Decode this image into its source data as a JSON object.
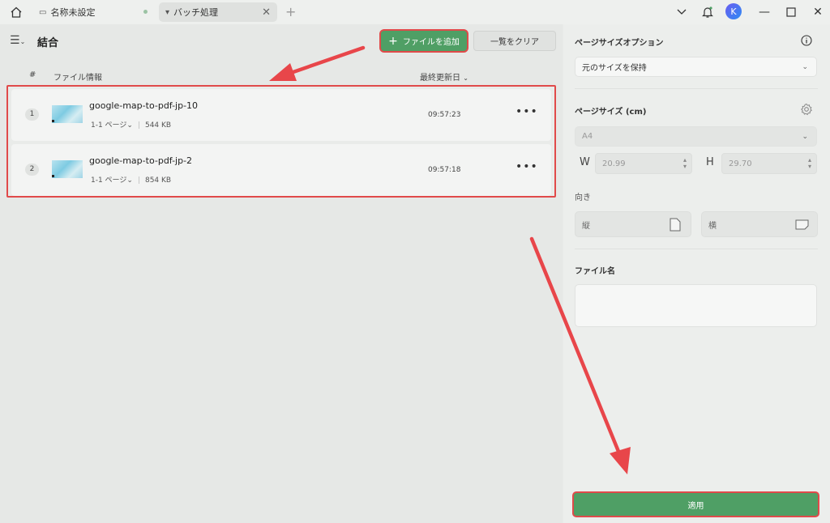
{
  "titlebar": {
    "tabs": [
      {
        "label": "名称未設定"
      },
      {
        "label": "バッチ処理"
      }
    ],
    "avatar_letter": "K"
  },
  "toolbar": {
    "title": "結合",
    "add_label": "ファイルを追加",
    "clear_label": "一覧をクリア"
  },
  "table": {
    "headers": {
      "index": "#",
      "file_info": "ファイル情報",
      "modified": "最終更新日"
    },
    "rows": [
      {
        "num": "1",
        "name": "google-map-to-pdf-jp-10",
        "pages": "1-1 ページ",
        "size": "544 KB",
        "time": "09:57:23"
      },
      {
        "num": "2",
        "name": "google-map-to-pdf-jp-2",
        "pages": "1-1 ページ",
        "size": "854 KB",
        "time": "09:57:18"
      }
    ]
  },
  "options": {
    "page_size_option_title": "ページサイズオプション",
    "page_size_option_value": "元のサイズを保持",
    "page_size_title": "ページサイズ (cm)",
    "paper": "A4",
    "w_label": "W",
    "w_value": "20.99",
    "h_label": "H",
    "h_value": "29.70",
    "orientation_title": "向き",
    "portrait": "縦",
    "landscape": "横",
    "filename_title": "ファイル名",
    "filename_value": "",
    "apply_label": "適用"
  },
  "colors": {
    "accent": "#4f9f65",
    "highlight": "#e04a4a"
  }
}
